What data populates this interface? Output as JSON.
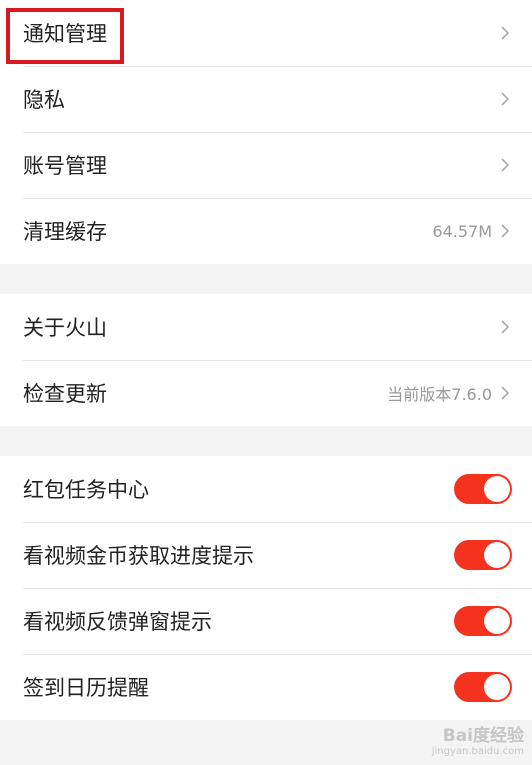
{
  "colors": {
    "accent": "#f5321e",
    "highlight": "#d9191f",
    "background": "#f4f4f4",
    "row_bg": "#ffffff"
  },
  "group1": {
    "notifications": {
      "label": "通知管理",
      "icon": "chevron-right-icon"
    },
    "privacy": {
      "label": "隐私",
      "icon": "chevron-right-icon"
    },
    "account": {
      "label": "账号管理",
      "icon": "chevron-right-icon"
    },
    "cache": {
      "label": "清理缓存",
      "value": "64.57M",
      "icon": "chevron-right-icon"
    }
  },
  "group2": {
    "about": {
      "label": "关于火山",
      "icon": "chevron-right-icon"
    },
    "update": {
      "label": "检查更新",
      "value": "当前版本7.6.0",
      "icon": "chevron-right-icon"
    }
  },
  "group3": {
    "red_packet": {
      "label": "红包任务中心",
      "enabled": true
    },
    "coin_progress": {
      "label": "看视频金币获取进度提示",
      "enabled": true
    },
    "feedback_popup": {
      "label": "看视频反馈弹窗提示",
      "enabled": true
    },
    "checkin_reminder": {
      "label": "签到日历提醒",
      "enabled": true
    }
  },
  "watermark": {
    "brand": "Bai度经验",
    "url": "jingyan.baidu.com"
  }
}
